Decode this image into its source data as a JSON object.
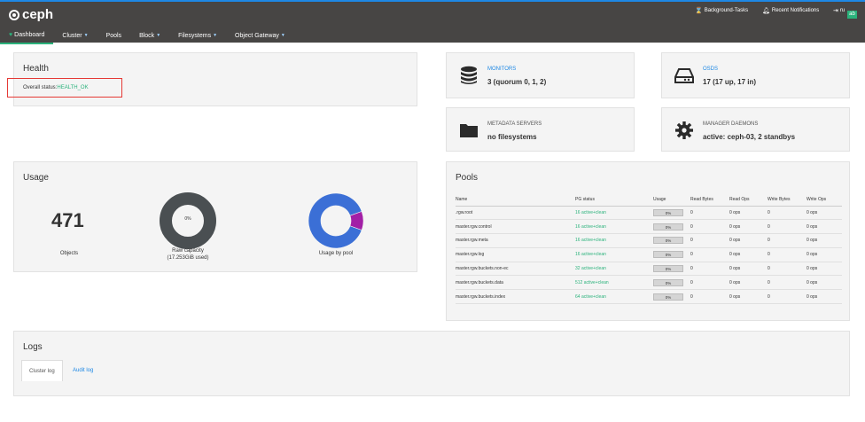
{
  "app": {
    "name": "ceph"
  },
  "header": {
    "background_tasks": "Background-Tasks",
    "recent_notifications": "Recent Notifications",
    "user_text": "ru",
    "user_badge": "ab"
  },
  "nav": {
    "items": [
      {
        "label": "Dashboard",
        "active": true,
        "dropdown": false
      },
      {
        "label": "Cluster",
        "active": false,
        "dropdown": true
      },
      {
        "label": "Pools",
        "active": false,
        "dropdown": false
      },
      {
        "label": "Block",
        "active": false,
        "dropdown": true
      },
      {
        "label": "Filesystems",
        "active": false,
        "dropdown": true
      },
      {
        "label": "Object Gateway",
        "active": false,
        "dropdown": true
      }
    ]
  },
  "health": {
    "title": "Health",
    "status_label": "Overall status:",
    "status_value": "HEALTH_OK"
  },
  "cards": {
    "monitors": {
      "label": "MONITORS",
      "value": "3 (quorum 0, 1, 2)",
      "icon": "database-icon"
    },
    "osds": {
      "label": "OSDS",
      "value": "17 (17 up, 17 in)",
      "icon": "hdd-icon"
    },
    "mds": {
      "label": "METADATA SERVERS",
      "value": "no filesystems",
      "icon": "folder-icon"
    },
    "mgr": {
      "label": "MANAGER DAEMONS",
      "value": "active: ceph-03, 2 standbys",
      "icon": "gear-icon"
    }
  },
  "usage": {
    "title": "Usage",
    "objects_count": "471",
    "objects_label": "Objects",
    "raw_capacity_label": "Raw capacity",
    "raw_capacity_detail": "(17.253GiB used)",
    "raw_capacity_percent": "0%",
    "raw_capacity_fraction": 0.0,
    "usage_by_pool_label": "Usage by pool",
    "pool_pie_slices": [
      0.89,
      0.11
    ],
    "colors": {
      "donut_dark": "#4a4f52",
      "pool_main": "#3b6fd6",
      "pool_other": "#a21fa6"
    }
  },
  "pools": {
    "title": "Pools",
    "columns": [
      "Name",
      "PG status",
      "Usage",
      "Read Bytes",
      "Read Ops",
      "Write Bytes",
      "Write Ops"
    ],
    "rows": [
      {
        "name": ".rgw.root",
        "pg": "16 active+clean",
        "usage": "0%",
        "read_bytes": "0",
        "read_ops": "0 ops",
        "write_bytes": "0",
        "write_ops": "0 ops"
      },
      {
        "name": "master.rgw.control",
        "pg": "16 active+clean",
        "usage": "0%",
        "read_bytes": "0",
        "read_ops": "0 ops",
        "write_bytes": "0",
        "write_ops": "0 ops"
      },
      {
        "name": "master.rgw.meta",
        "pg": "16 active+clean",
        "usage": "0%",
        "read_bytes": "0",
        "read_ops": "0 ops",
        "write_bytes": "0",
        "write_ops": "0 ops"
      },
      {
        "name": "master.rgw.log",
        "pg": "16 active+clean",
        "usage": "0%",
        "read_bytes": "0",
        "read_ops": "0 ops",
        "write_bytes": "0",
        "write_ops": "0 ops"
      },
      {
        "name": "master.rgw.buckets.non-ec",
        "pg": "32 active+clean",
        "usage": "0%",
        "read_bytes": "0",
        "read_ops": "0 ops",
        "write_bytes": "0",
        "write_ops": "0 ops"
      },
      {
        "name": "master.rgw.buckets.data",
        "pg": "512 active+clean",
        "usage": "0%",
        "read_bytes": "0",
        "read_ops": "0 ops",
        "write_bytes": "0",
        "write_ops": "0 ops"
      },
      {
        "name": "master.rgw.buckets.index",
        "pg": "64 active+clean",
        "usage": "0%",
        "read_bytes": "0",
        "read_ops": "0 ops",
        "write_bytes": "0",
        "write_ops": "0 ops"
      }
    ]
  },
  "logs": {
    "title": "Logs",
    "tabs": [
      {
        "label": "Cluster log",
        "active": true
      },
      {
        "label": "Audit log",
        "active": false
      }
    ]
  },
  "colors": {
    "accent": "#2ab27b",
    "link": "#1e88e5",
    "topbar": "#474544",
    "alert_box": "#e53935"
  }
}
